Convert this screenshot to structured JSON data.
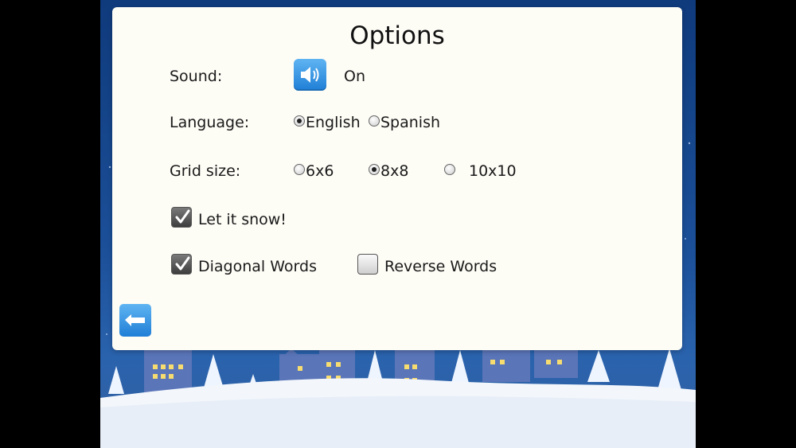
{
  "title": "Options",
  "sound": {
    "label": "Sound:",
    "value": "On",
    "icon": "speaker-icon"
  },
  "language": {
    "label": "Language:",
    "options": [
      "English",
      "Spanish"
    ],
    "selected": "English"
  },
  "grid_size": {
    "label": "Grid size:",
    "options": [
      "6x6",
      "8x8",
      "10x10"
    ],
    "selected": "8x8"
  },
  "checkboxes": {
    "snow": {
      "label": "Let it snow!",
      "checked": true
    },
    "diagonal": {
      "label": "Diagonal Words",
      "checked": true
    },
    "reverse": {
      "label": "Reverse Words",
      "checked": false
    }
  },
  "back_button": {
    "icon": "back-arrow-icon"
  },
  "colors": {
    "button_blue": "#2b8ae0",
    "panel": "#fdfcf5",
    "sky": "#1b4f98"
  }
}
